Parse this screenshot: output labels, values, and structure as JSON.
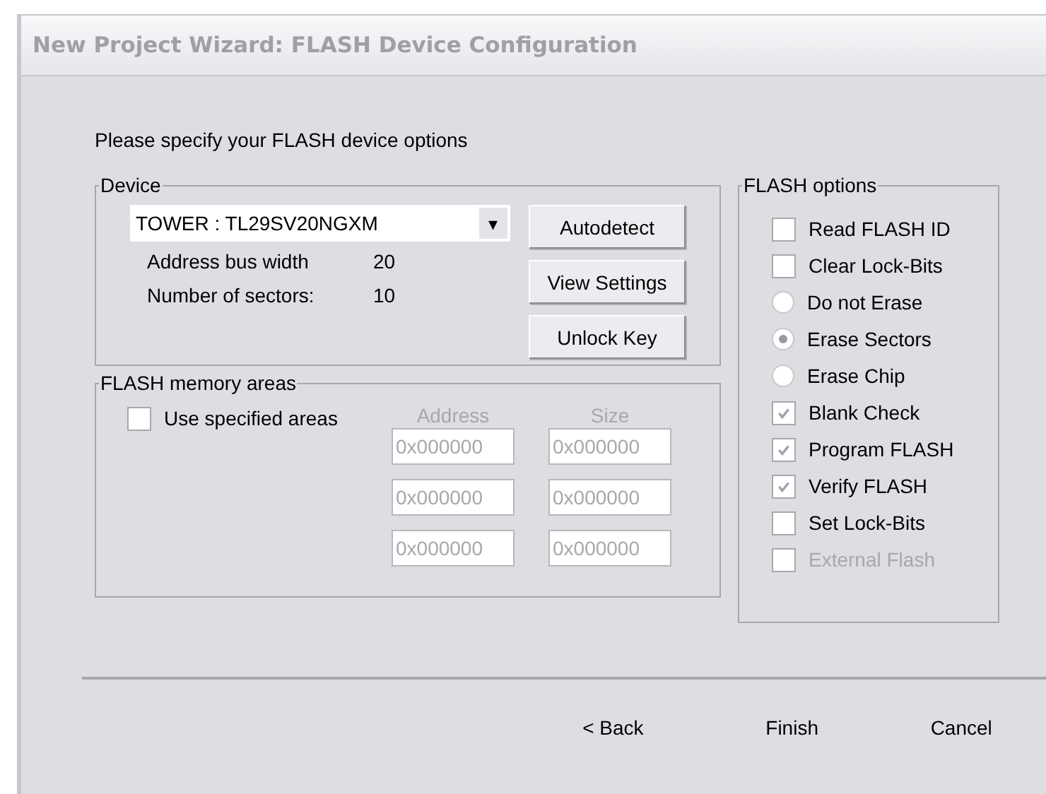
{
  "window": {
    "title": "New Project Wizard: FLASH Device Configuration"
  },
  "intro": "Please specify your FLASH device options",
  "device": {
    "legend": "Device",
    "selected_device": "TOWER : TL29SV20NGXM",
    "dropdown_glyph": "▾",
    "info": [
      {
        "label": "Address bus width",
        "value": "20"
      },
      {
        "label": "Number of sectors:",
        "value": "10"
      }
    ],
    "buttons": [
      "Autodetect",
      "View Settings",
      "Unlock Key"
    ]
  },
  "memory_areas": {
    "legend": "FLASH memory areas",
    "use_specified": {
      "label": "Use specified areas",
      "checked": false
    },
    "disabled": true,
    "columns": [
      "Address",
      "Size"
    ],
    "rows": [
      [
        "0x000000",
        "0x000000"
      ],
      [
        "0x000000",
        "0x000000"
      ],
      [
        "0x000000",
        "0x000000"
      ]
    ]
  },
  "flash_options": {
    "legend": "FLASH options",
    "items": [
      {
        "kind": "checkbox",
        "label": "Read FLASH ID",
        "checked": false,
        "disabled": false
      },
      {
        "kind": "checkbox",
        "label": "Clear Lock-Bits",
        "checked": false,
        "disabled": false
      },
      {
        "kind": "radio",
        "label": "Do not Erase",
        "selected": false
      },
      {
        "kind": "radio",
        "label": "Erase Sectors",
        "selected": true
      },
      {
        "kind": "radio",
        "label": "Erase Chip",
        "selected": false
      },
      {
        "kind": "checkbox",
        "label": "Blank Check",
        "checked": true,
        "disabled": false
      },
      {
        "kind": "checkbox",
        "label": "Program FLASH",
        "checked": true,
        "disabled": false
      },
      {
        "kind": "checkbox",
        "label": "Verify FLASH",
        "checked": true,
        "disabled": false
      },
      {
        "kind": "checkbox",
        "label": "Set Lock-Bits",
        "checked": false,
        "disabled": false
      },
      {
        "kind": "checkbox",
        "label": "External Flash",
        "checked": false,
        "disabled": true
      }
    ]
  },
  "footer_buttons": [
    "< Back",
    "Finish",
    "Cancel"
  ]
}
